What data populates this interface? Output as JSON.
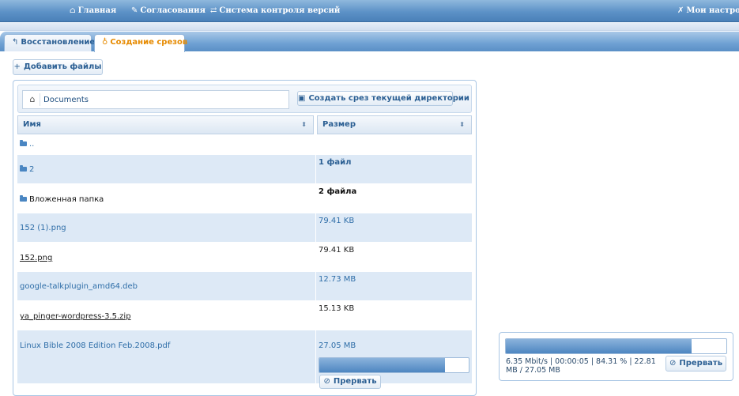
{
  "nav": {
    "home": {
      "label": "Главная",
      "icon": "home-icon"
    },
    "approvals": {
      "label": "Согласования",
      "icon": "pencil-icon"
    },
    "vcs": {
      "label": "Система контроля версий",
      "icon": "arrows-icon"
    },
    "settings": {
      "label": "Мои настройки",
      "icon": "wrench-icon"
    }
  },
  "tabs": [
    {
      "label": "Восстановление",
      "icon": "undo-icon",
      "active": false
    },
    {
      "label": "Создание срезов",
      "icon": "lightbulb-icon",
      "active": true
    }
  ],
  "actions": {
    "add_files": "Добавить файлы",
    "create_slice": "Создать срез текущей директории",
    "abort": "Прервать"
  },
  "breadcrumb": {
    "current": "Documents"
  },
  "table": {
    "columns": [
      "Имя",
      "Размер"
    ],
    "rows": [
      {
        "name": "..",
        "size": "",
        "type": "parent"
      },
      {
        "name": "2",
        "size": "1 файл",
        "type": "folder"
      },
      {
        "name": "Вложенная папка",
        "size": "2 файла",
        "type": "folder"
      },
      {
        "name": "152 (1).png",
        "size": "79.41 KB",
        "type": "file"
      },
      {
        "name": "152.png",
        "size": "79.41 KB",
        "type": "file"
      },
      {
        "name": "google-talkplugin_amd64.deb",
        "size": "12.73 MB",
        "type": "file"
      },
      {
        "name": "ya_pinger-wordpress-3.5.zip",
        "size": "15.13 KB",
        "type": "file"
      },
      {
        "name": "Linux Bible 2008 Edition Feb.2008.pdf",
        "size": "27.05 MB",
        "type": "file",
        "progress": 0.84
      }
    ]
  },
  "upload": {
    "stats": "6.35 Mbit/s | 00:00:05 | 84.31 % | 22.81 MB / 27.05 MB",
    "progress": 0.8431
  },
  "colors": {
    "accent": "#5d92c7",
    "active_tab": "#e68a00",
    "row_alt": "#dde9f6"
  }
}
